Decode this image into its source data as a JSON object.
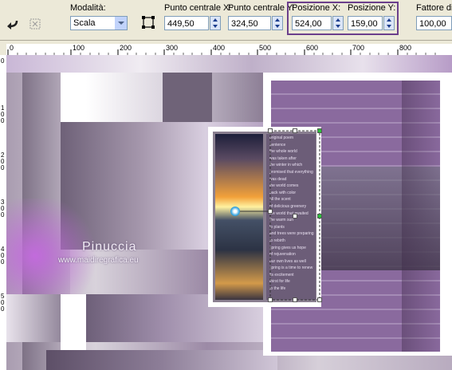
{
  "toolbar": {
    "mode_label": "Modalità:",
    "mode_value": "Scala",
    "center_x_label": "Punto centrale X:",
    "center_x_value": "449,50",
    "center_y_label": "Punto centrale Y:",
    "center_y_value": "324,50",
    "pos_x_label": "Posizione X:",
    "pos_x_value": "524,00",
    "pos_y_label": "Posizione Y:",
    "pos_y_value": "159,00",
    "factor_label": "Fattore di s",
    "factor_value": "100,00",
    "icons": [
      "reset-arrow-icon",
      "pick-tool-icon",
      "deformation-icon"
    ]
  },
  "ruler": {
    "top_labels": [
      "0",
      "100",
      "200",
      "300",
      "400",
      "500",
      "600",
      "700",
      "800"
    ],
    "left_labels": [
      "0",
      "1\n0\n0",
      "2\n0\n0",
      "3\n0\n0",
      "4\n0\n0",
      "5\n0\n0"
    ]
  },
  "watermark": {
    "title": "Pinuccia",
    "url": "www.maidiregrafica.eu"
  },
  "poem_lines": [
    "original poem",
    "sentence",
    "the whole world",
    "was taken after",
    "the winter in which",
    "promised that everything",
    "was dead",
    "the world comes",
    "back with color",
    "all the scent",
    "of delicious greenery",
    "the world that awaited",
    "the warm sun",
    "to plants",
    "and trees were preparing",
    "to rebirth",
    "spring gives us hope",
    "of rejuvenation",
    "our own lives as well",
    "spring is a time to renew",
    "its excitement",
    "thirst for life",
    "to the life"
  ],
  "colors": {
    "highlight": "#6b3f8c",
    "purple": "#8a6a9e",
    "canvas_bg": "#d9d6dd"
  }
}
